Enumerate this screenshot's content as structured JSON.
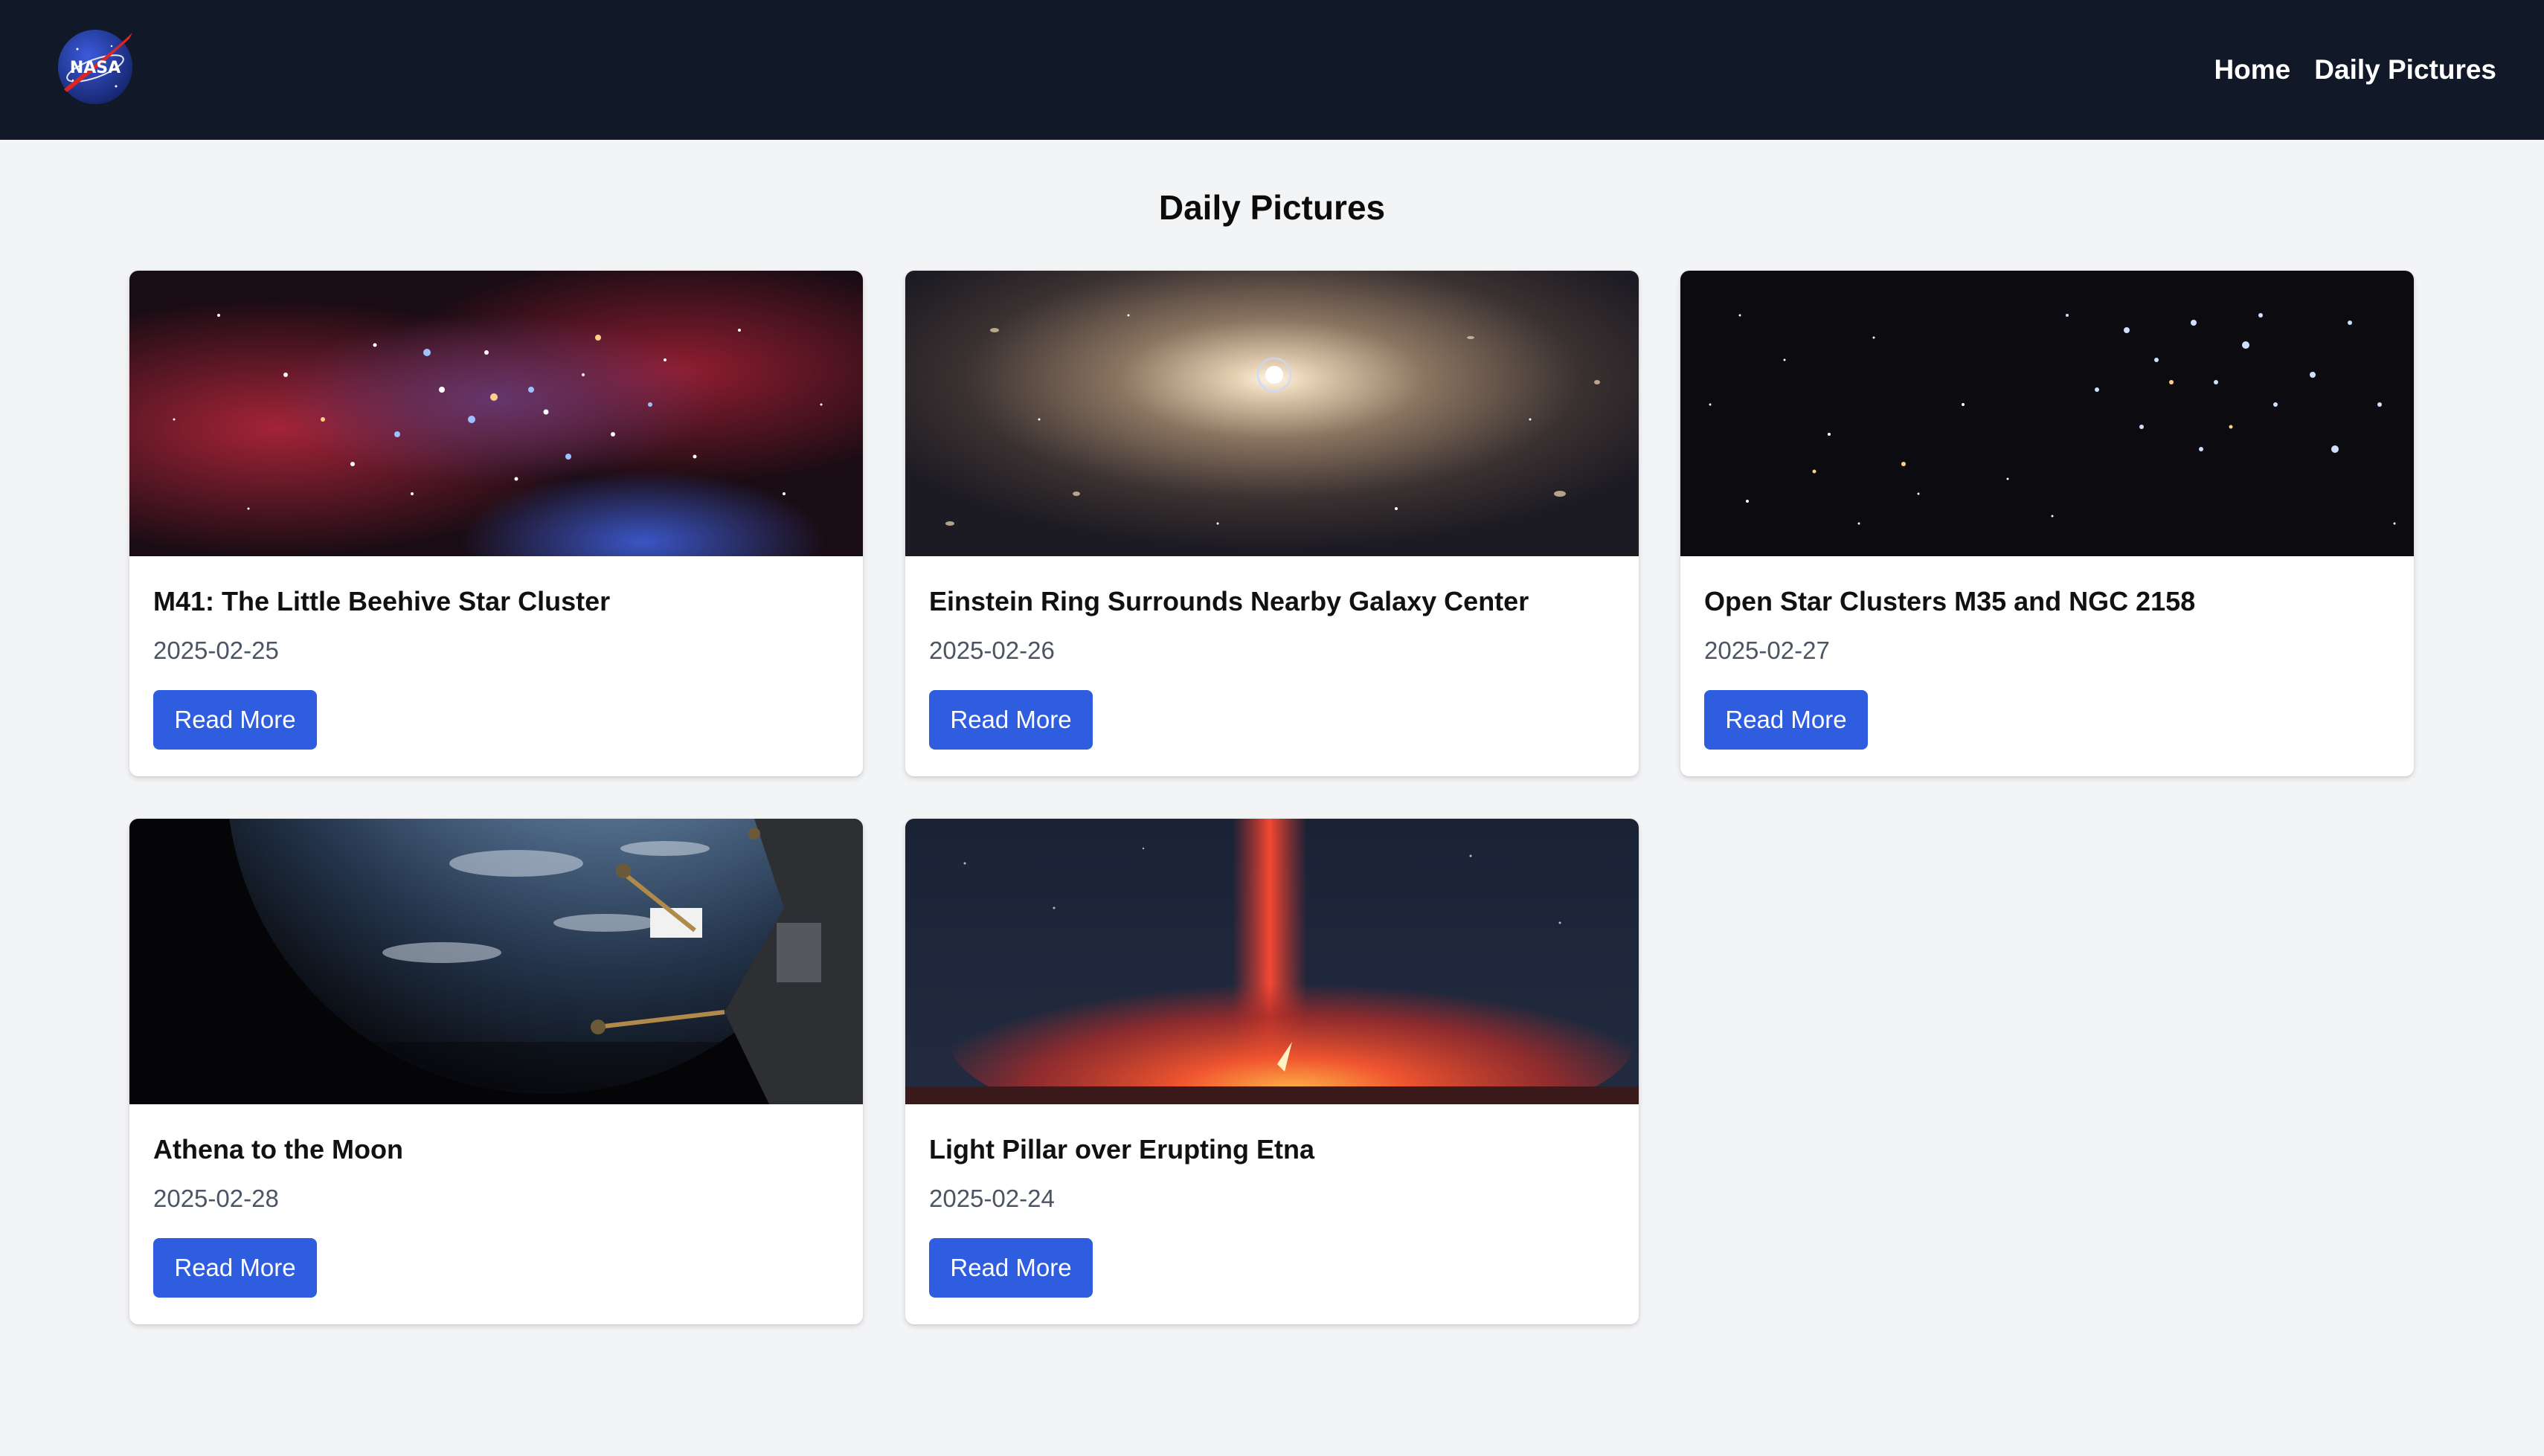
{
  "nav": {
    "logo_text": "NASA",
    "links": [
      "Home",
      "Daily Pictures"
    ]
  },
  "page_title": "Daily Pictures",
  "cards": [
    {
      "title": "M41: The Little Beehive Star Cluster",
      "date": "2025-02-25",
      "button": "Read More"
    },
    {
      "title": "Einstein Ring Surrounds Nearby Galaxy Center",
      "date": "2025-02-26",
      "button": "Read More"
    },
    {
      "title": "Open Star Clusters M35 and NGC 2158",
      "date": "2025-02-27",
      "button": "Read More"
    },
    {
      "title": "Athena to the Moon",
      "date": "2025-02-28",
      "button": "Read More"
    },
    {
      "title": "Light Pillar over Erupting Etna",
      "date": "2025-02-24",
      "button": "Read More"
    }
  ],
  "colors": {
    "navbar": "#111827",
    "background": "#f3f4f6",
    "button": "#2f5de0"
  }
}
